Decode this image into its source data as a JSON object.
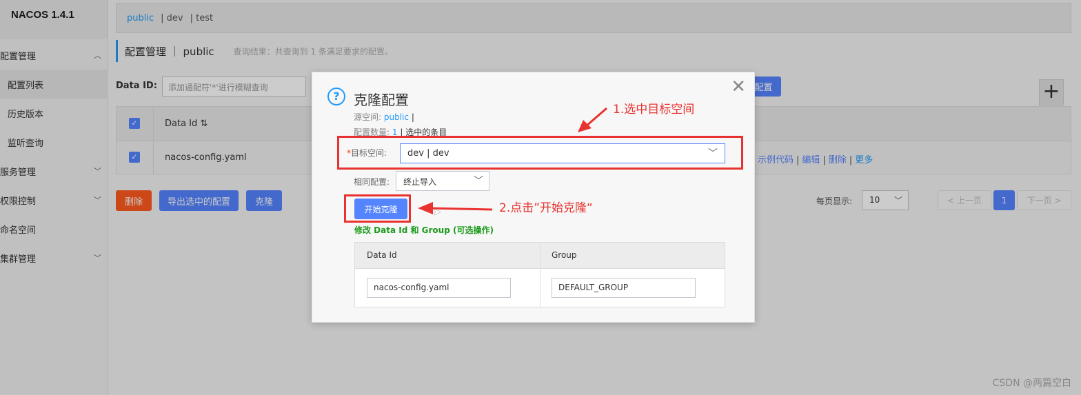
{
  "app": {
    "logo": "NACOS 1.4.1"
  },
  "sidebar": {
    "items": [
      {
        "label": "配置管理",
        "chev": "^"
      },
      {
        "label": "配置列表"
      },
      {
        "label": "历史版本"
      },
      {
        "label": "监听查询"
      },
      {
        "label": "服务管理",
        "chev": "v"
      },
      {
        "label": "权限控制",
        "chev": "v"
      },
      {
        "label": "命名空间"
      },
      {
        "label": "集群管理",
        "chev": "v"
      }
    ]
  },
  "env_tabs": [
    "public",
    "| dev",
    "| test"
  ],
  "header": {
    "title": "配置管理 ｜ public",
    "result": "查询结果：共查询到 1 条满足要求的配置。"
  },
  "search": {
    "label": "Data ID:",
    "placeholder": "添加通配符'*'进行模糊查询",
    "query_btn": "配置"
  },
  "table": {
    "header_dataid": "Data Id ⇅",
    "rows": [
      {
        "dataid": "nacos-config.yaml"
      }
    ],
    "ops": {
      "example": "示例代码",
      "edit": "编辑",
      "delete": "删除",
      "more": "更多"
    }
  },
  "actions": {
    "delete": "删除",
    "export": "导出选中的配置",
    "clone": "克隆"
  },
  "pager": {
    "label": "每页显示:",
    "size": "10",
    "prev": "< 上一页",
    "current": "1",
    "next": "下一页 >"
  },
  "dialog": {
    "title": "克隆配置",
    "src_label": "源空间:",
    "src_value": "public",
    "src_suffix": "|",
    "count_label": "配置数量:",
    "count_value": "1",
    "count_suffix": "| 选中的条目",
    "target_req": "*",
    "target_label": "目标空间:",
    "target_value": "dev | dev",
    "same_label": "相同配置:",
    "same_value": "终止导入",
    "start_btn": "开始克隆",
    "modify_label": "修改 Data Id 和 Group (可选操作)",
    "col_dataid": "Data Id",
    "col_group": "Group",
    "dataid_value": "nacos-config.yaml",
    "group_value": "DEFAULT_GROUP"
  },
  "annotations": {
    "step1": "1.选中目标空间",
    "step2": "2.点击”开始克隆“"
  },
  "watermark": "CSDN @两篇空白",
  "colors": {
    "primary": "#5584ff",
    "link": "#209bfa",
    "danger": "#ff5a1f",
    "annotation": "#e8322f",
    "success": "#1a9a1a"
  }
}
